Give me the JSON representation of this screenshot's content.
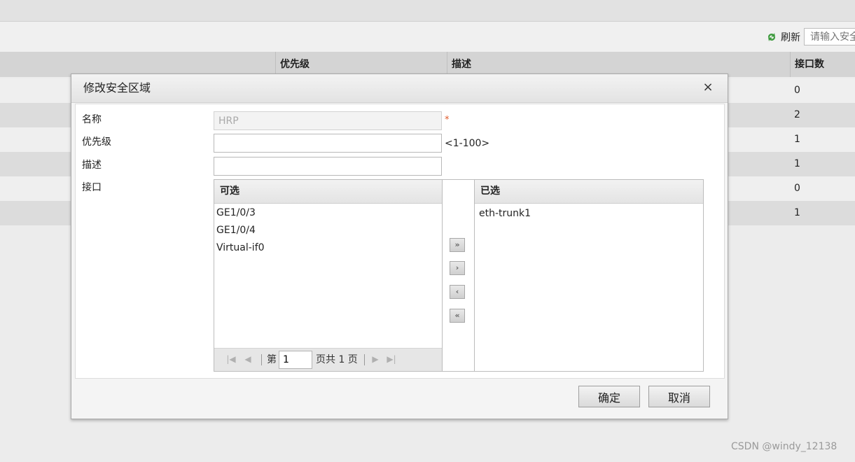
{
  "toolbar": {
    "refresh_label": "刷新",
    "search_placeholder": "请输入安全"
  },
  "table": {
    "headers": {
      "priority": "优先级",
      "description": "描述",
      "interface_count": "接口数"
    },
    "rows": [
      {
        "interface_count": "0"
      },
      {
        "interface_count": "2"
      },
      {
        "interface_count": "1"
      },
      {
        "interface_count": "1"
      },
      {
        "interface_count": "0"
      },
      {
        "interface_count": "1"
      }
    ]
  },
  "dialog": {
    "title": "修改安全区域",
    "close_symbol": "×",
    "fields": {
      "name_label": "名称",
      "name_value": "HRP",
      "required_mark": "*",
      "priority_label": "优先级",
      "priority_value": "",
      "priority_hint": "<1-100>",
      "description_label": "描述",
      "description_value": "",
      "interface_label": "接口"
    },
    "available": {
      "header": "可选",
      "items": [
        "GE1/0/3",
        "GE1/0/4",
        "Virtual-if0"
      ],
      "pager": {
        "page_prefix": "第",
        "page_value": "1",
        "page_suffix": "页共 1 页"
      }
    },
    "selected": {
      "header": "已选",
      "items": [
        "eth-trunk1"
      ]
    },
    "move_buttons": {
      "add_all": "»",
      "add": "›",
      "remove": "‹",
      "remove_all": "«"
    },
    "confirm_label": "确定",
    "cancel_label": "取消"
  },
  "watermark": "CSDN @windy_12138",
  "colors": {
    "refresh_icon": "#3c9a3c",
    "required": "#e05a2a"
  }
}
